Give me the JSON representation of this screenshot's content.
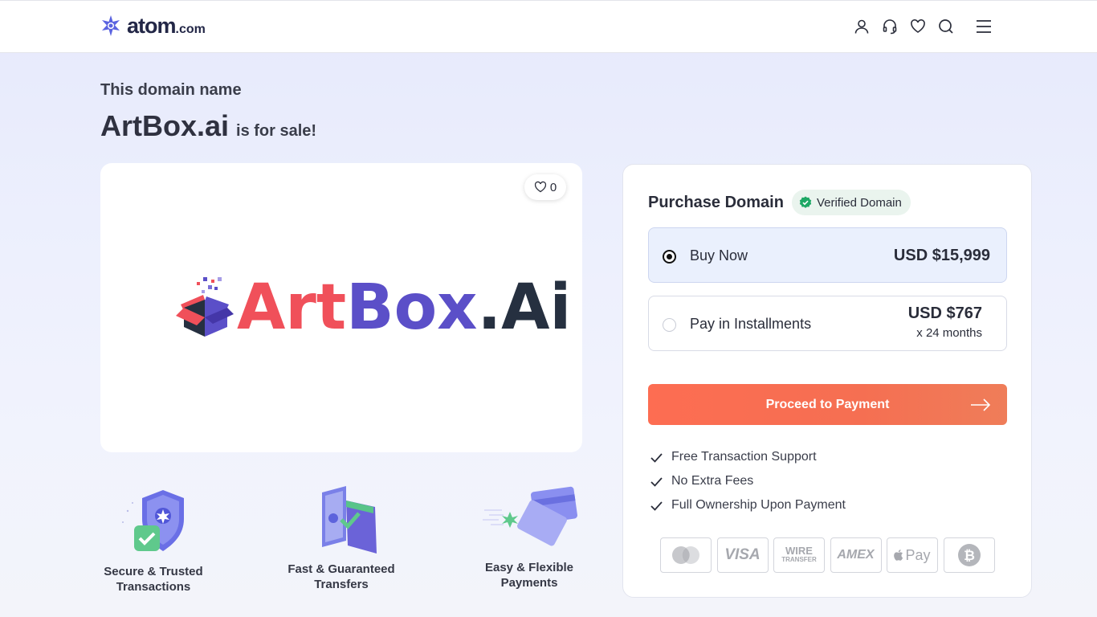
{
  "header": {
    "brand": "atom",
    "brand_suffix": ".com",
    "icons": [
      "user-icon",
      "headset-icon",
      "heart-icon",
      "search-icon",
      "menu-icon"
    ]
  },
  "hero": {
    "eyebrow": "This domain name",
    "domain": "ArtBox.ai",
    "for_sale": "is for sale!"
  },
  "logo_card": {
    "likes": "0",
    "logo_words": {
      "art": "Art",
      "box": "Box",
      "ai": ".Ai"
    }
  },
  "features": [
    {
      "label_line1": "Secure & Trusted",
      "label_line2": "Transactions",
      "icon": "shield-check-icon"
    },
    {
      "label_line1": "Fast & Guaranteed",
      "label_line2": "Transfers",
      "icon": "transfer-icon"
    },
    {
      "label_line1": "Easy & Flexible",
      "label_line2": "Payments",
      "icon": "cards-icon"
    }
  ],
  "purchase": {
    "title": "Purchase Domain",
    "verified_label": "Verified Domain",
    "options": [
      {
        "label": "Buy Now",
        "price": "USD $15,999",
        "selected": true
      },
      {
        "label": "Pay in Installments",
        "price": "USD $767",
        "sub": "x 24 months",
        "selected": false
      }
    ],
    "proceed_label": "Proceed to Payment",
    "benefits": [
      "Free Transaction Support",
      "No Extra Fees",
      "Full Ownership Upon Payment"
    ],
    "payment_methods": [
      "mastercard-icon",
      "visa-icon",
      "wire-transfer-icon",
      "amex-icon",
      "apple-pay-icon",
      "bitcoin-icon"
    ],
    "payment_labels": {
      "visa": "VISA",
      "wire1": "WIRE",
      "wire2": "TRANSFER",
      "amex": "AMEX",
      "apple_pay": "Pay"
    }
  },
  "colors": {
    "accent": "#fd6d52",
    "brand": "#5b4fc8",
    "verified": "#1ea865"
  }
}
